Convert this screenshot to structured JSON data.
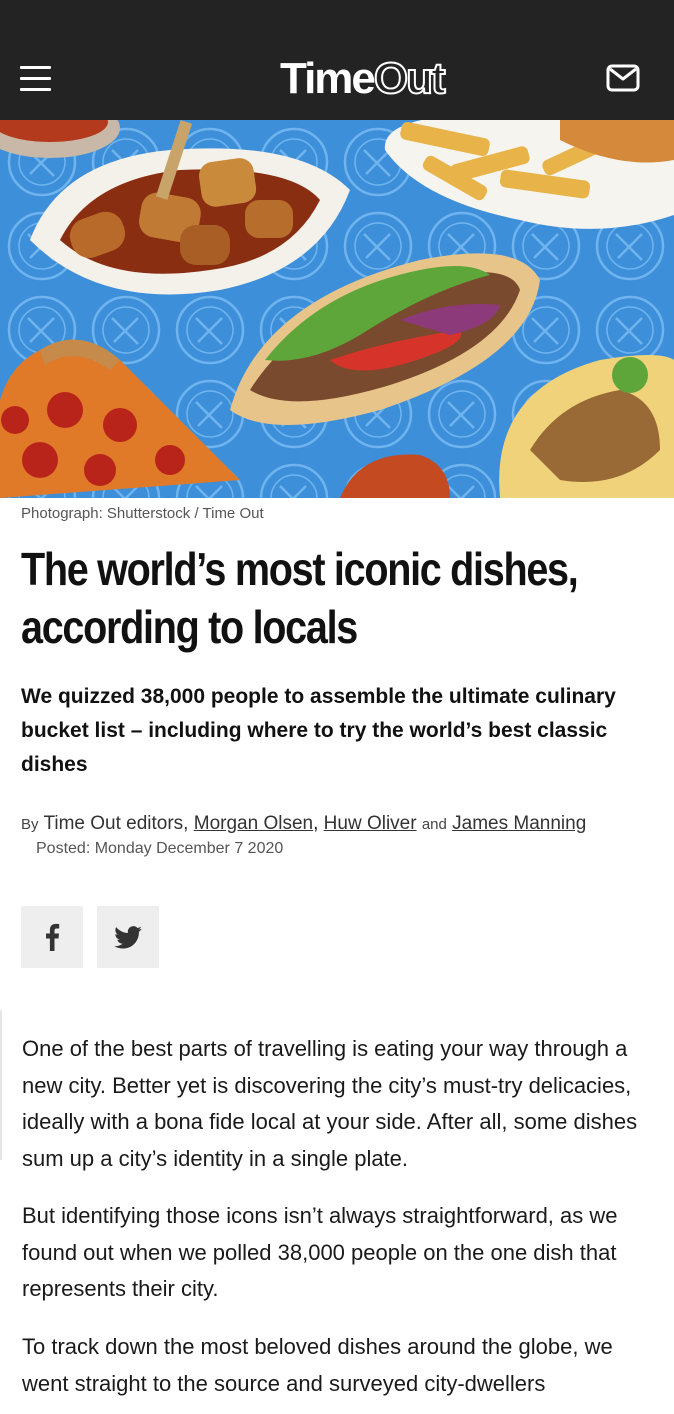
{
  "header": {
    "brand": "TimeOut",
    "brand_parts": [
      "Time",
      "Out"
    ],
    "menu_icon": "hamburger-menu-icon",
    "mail_icon": "envelope-icon",
    "background": "#232323"
  },
  "hero": {
    "caption": "Photograph: Shutterstock / Time Out",
    "background": "#3d8fd9"
  },
  "article": {
    "title": "The world’s most iconic dishes, according to locals",
    "standfirst": "We quizzed 38,000 people to assemble the ultimate culinary bucket list – including where to try the world’s best classic dishes",
    "byline": {
      "by": "By",
      "team": "Time Out editors,",
      "authors": [
        "Morgan Olsen",
        "Huw Oliver",
        "James Manning"
      ],
      "comma": ",",
      "and": "and"
    },
    "posted": "Posted: Monday December 7 2020",
    "share": {
      "facebook_icon": "facebook-icon",
      "twitter_icon": "twitter-icon"
    },
    "paragraphs": [
      "One of the best parts of travelling is eating your way through a new city. Better yet is discovering the city’s must-try delicacies, ideally with a bona fide local at your side. After all, some dishes sum up a city’s identity in a single plate.",
      "But identifying those icons isn’t always straightforward, as we found out when we polled 38,000 people on the one dish that represents their city.",
      "To track down the most beloved dishes around the globe, we went straight to the source and surveyed city-dwellers"
    ],
    "link_color": "#d32f2f"
  }
}
